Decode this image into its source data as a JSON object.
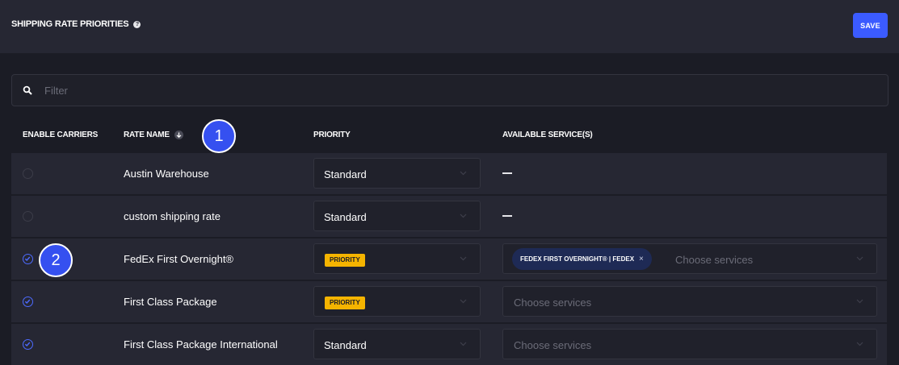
{
  "header": {
    "title": "SHIPPING RATE PRIORITIES",
    "help_glyph": "?",
    "save_label": "SAVE"
  },
  "filter": {
    "placeholder": "Filter"
  },
  "columns": {
    "enable_carriers": "ENABLE CARRIERS",
    "rate_name": "RATE NAME",
    "priority": "PRIORITY",
    "available_services": "AVAILABLE SERVICE(S)"
  },
  "rows": [
    {
      "name": "Austin Warehouse",
      "enabled": false,
      "priority": "Standard",
      "services": "—"
    },
    {
      "name": "custom shipping rate",
      "enabled": false,
      "priority": "Standard",
      "services": "—"
    },
    {
      "name": "FedEx First Overnight®",
      "enabled": true,
      "priority": "PRIORITY",
      "chip": "FEDEX FIRST OVERNIGHT® | FEDEX",
      "chip_remove": "×",
      "placeholder": "Choose services"
    },
    {
      "name": "First Class Package",
      "enabled": true,
      "priority": "PRIORITY",
      "placeholder": "Choose services"
    },
    {
      "name": "First Class Package International",
      "enabled": true,
      "priority": "Standard",
      "placeholder": "Choose services"
    }
  ],
  "markers": {
    "m1": "1",
    "m2": "2"
  },
  "colors": {
    "accent": "#3b5bff",
    "priority_badge": "#f5b400",
    "background": "#1b1c25"
  },
  "icons": {
    "search": "search-icon",
    "sort": "arrow-down-icon",
    "chevron": "chevron-down-icon",
    "check": "check-circle-icon"
  }
}
